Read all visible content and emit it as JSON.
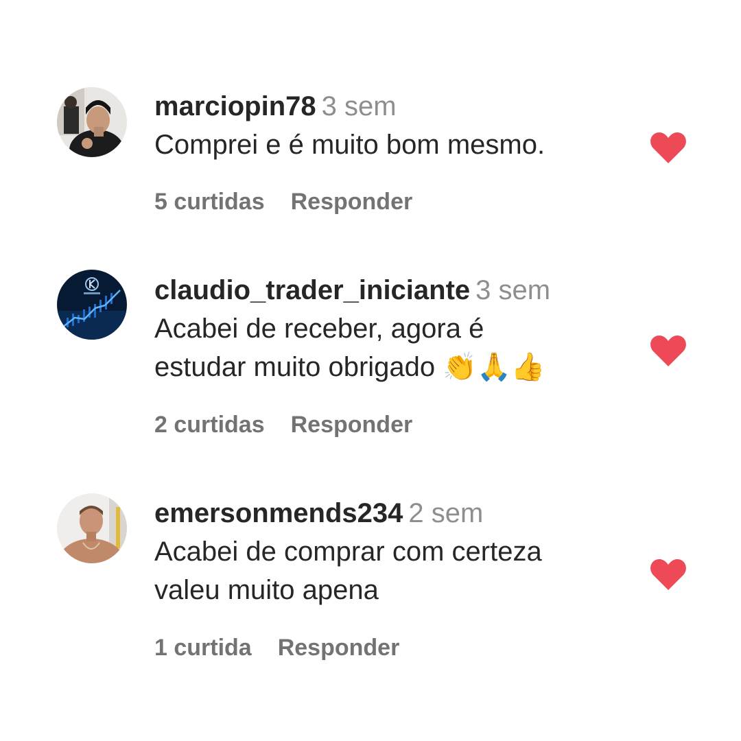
{
  "accent": {
    "heart_color": "#ed4956",
    "text_color": "#262626",
    "muted_color": "#8e8e8e",
    "action_color": "#737373"
  },
  "comments": [
    {
      "username": "marciopin78",
      "time": "3 sem",
      "text_lines": [
        "Comprei e é muito bom mesmo."
      ],
      "likes_label": "5 curtidas",
      "reply_label": "Responder",
      "liked": true,
      "avatar_icon": "profile-photo"
    },
    {
      "username": "claudio_trader_iniciante",
      "time": "3 sem",
      "text_lines": [
        "Acabei de receber, agora é",
        "estudar muito obrigado"
      ],
      "emojis": "👏🙏👍",
      "likes_label": "2 curtidas",
      "reply_label": "Responder",
      "liked": true,
      "avatar_icon": "trading-chart-logo"
    },
    {
      "username": "emersonmends234",
      "time": "2 sem",
      "text_lines": [
        "Acabei de comprar com certeza",
        "valeu muito apena"
      ],
      "likes_label": "1 curtida",
      "reply_label": "Responder",
      "liked": true,
      "avatar_icon": "profile-photo"
    }
  ]
}
